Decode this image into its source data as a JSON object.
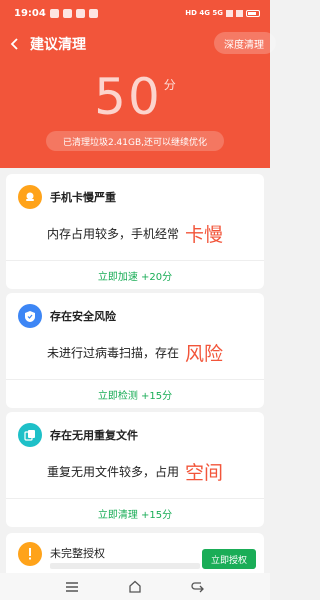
{
  "status": {
    "time": "19:04",
    "indicators": "HD 4G 5G",
    "battery_percent": 80
  },
  "header": {
    "title": "建议清理",
    "deep_clean": "深度清理",
    "score": "50",
    "score_unit": "分",
    "summary": "已清理垃圾2.41GB,还可以继续优化",
    "color": "#f2553a"
  },
  "cards": [
    {
      "title": "手机卡慢严重",
      "desc": "内存占用较多，手机经常",
      "highlight": "卡慢",
      "action": "立即加速 +20分",
      "icon": "snail-icon",
      "icon_color": "#ffa31a"
    },
    {
      "title": "存在安全风险",
      "desc": "未进行过病毒扫描，存在",
      "highlight": "风险",
      "action": "立即检测 +15分",
      "icon": "shield-icon",
      "icon_color": "#3d86f5"
    },
    {
      "title": "存在无用重复文件",
      "desc": "重复无用文件较多，占用",
      "highlight": "空间",
      "action": "立即清理 +15分",
      "icon": "duplicate-files-icon",
      "icon_color": "#1ec0c8"
    }
  ],
  "card4": {
    "title": "未完整授权",
    "button": "立即授权",
    "icon": "alert-icon"
  },
  "colors": {
    "accent_green": "#1aad57",
    "highlight_red": "#f2553a"
  }
}
